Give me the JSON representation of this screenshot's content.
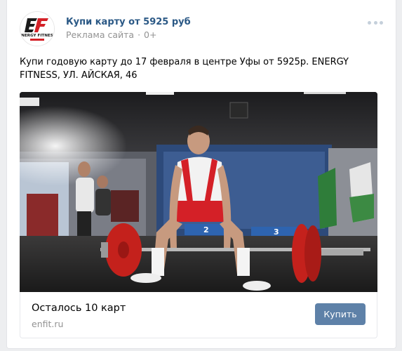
{
  "post": {
    "author": "Купи карту от 5925 руб",
    "ad_label": "Реклама сайта",
    "age_rating": "0+",
    "text": "Купи годовую карту до 17 февраля в центре Уфы от 5925р. ENERGY FITNESS, УЛ. АЙСКАЯ, 46",
    "menu_icon": "more-dots-icon"
  },
  "logo": {
    "text": "ENERGY FITNESS",
    "brand_color": "#d42027"
  },
  "media": {
    "description_icon": "weightlifter-photo",
    "banner_numbers": [
      "2",
      "3"
    ]
  },
  "snippet": {
    "title": "Осталось 10 карт",
    "domain": "enfit.ru",
    "button_label": "Купить"
  },
  "colors": {
    "link": "#2a5885",
    "button": "#5e81a8",
    "muted": "#939393",
    "background": "#edeef0"
  }
}
